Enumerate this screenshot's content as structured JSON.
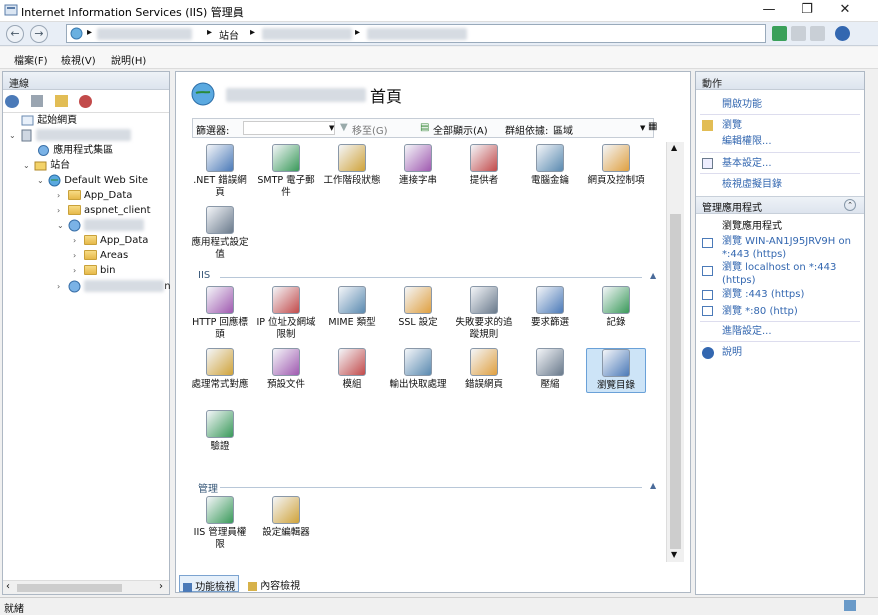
{
  "window": {
    "title": "Internet Information Services (IIS) 管理員",
    "minimize": "—",
    "maximize": "❐",
    "close": "✕"
  },
  "address": {
    "crumb_site": "站台",
    "sep": "▸"
  },
  "menu": {
    "file": "檔案(F)",
    "view": "檢視(V)",
    "help": "說明(H)"
  },
  "left": {
    "header": "連線",
    "tree": {
      "start": "起始網頁",
      "app_pools": "應用程式集區",
      "sites": "站台",
      "default_site": "Default Web Site",
      "app_data": "App_Data",
      "aspnet_client": "aspnet_client",
      "app_data2": "App_Data",
      "areas": "Areas",
      "bin": "bin",
      "n_suffix": "n"
    }
  },
  "center": {
    "title": "首頁",
    "filter_label": "篩選器:",
    "go_label": "移至(G)",
    "show_all": "全部顯示(A)",
    "group_by": "群組依據:",
    "group_value": "區域",
    "aspnet_items": [
      ".NET 錯誤網頁",
      "SMTP 電子郵件",
      "工作階段狀態",
      "連接字串",
      "提供者",
      "電腦金鑰",
      "網頁及控制項",
      "應用程式設定值"
    ],
    "iis_group": "IIS",
    "iis_items": [
      "HTTP 回應標頭",
      "IP 位址及網域限制",
      "MIME 類型",
      "SSL 設定",
      "失敗要求的追蹤規則",
      "要求篩選",
      "記錄",
      "處理常式對應",
      "預設文件",
      "模組",
      "輸出快取處理",
      "錯誤網頁",
      "壓縮",
      "瀏覽目錄",
      "驗證"
    ],
    "mgmt_group": "管理",
    "mgmt_items": [
      "IIS 管理員權限",
      "設定編輯器"
    ],
    "tab_features": "功能檢視",
    "tab_content": "內容檢視"
  },
  "right": {
    "header": "動作",
    "open": "開啟功能",
    "explore": "瀏覽",
    "edit_perms": "編輯權限...",
    "basic": "基本設定...",
    "vdirs": "檢視虛擬目錄",
    "manage_app": "管理應用程式",
    "browse_app": "瀏覽應用程式",
    "browse1": "瀏覽 WIN-AN1J95JRV9H on *:443 (https)",
    "browse2": "瀏覽 localhost on *:443 (https)",
    "browse3": "瀏覽 :443 (https)",
    "browse4": "瀏覽 *:80 (http)",
    "advanced": "進階設定...",
    "help": "說明"
  },
  "status": {
    "text": "就緒"
  },
  "colors": {
    "accent": "#3367b0",
    "selected": "#cde4f7"
  }
}
